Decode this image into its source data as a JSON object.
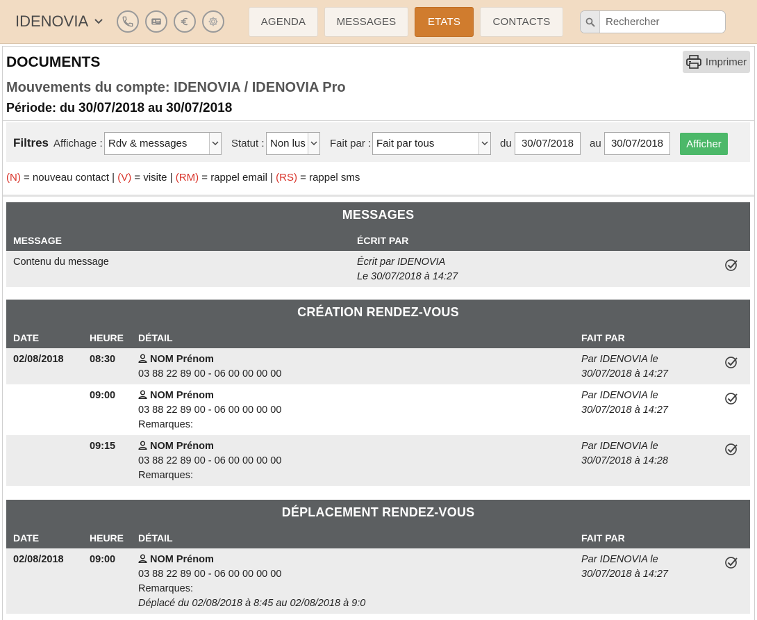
{
  "brand": {
    "name": "IDENOVIA"
  },
  "icons": [
    "phone-icon",
    "contacts-card-icon",
    "euro-icon",
    "gear-icon"
  ],
  "nav": {
    "tabs": [
      {
        "label": "AGENDA",
        "active": false
      },
      {
        "label": "MESSAGES",
        "active": false
      },
      {
        "label": "ETATS",
        "active": true
      },
      {
        "label": "CONTACTS",
        "active": false
      }
    ],
    "search_placeholder": "Rechercher"
  },
  "colors": {
    "topbar": "#f2dcc3",
    "active_tab": "#d07c2e",
    "header_gray": "#5c5f61",
    "action_green": "#4cb869",
    "legend_red": "#d9342b"
  },
  "page": {
    "title": "DOCUMENTS",
    "print_label": "Imprimer",
    "account_line": "Mouvements du compte: IDENOVIA / IDENOVIA Pro",
    "period_prefix": "Période: du",
    "period_from": "30/07/2018",
    "period_mid": "au",
    "period_to": "30/07/2018"
  },
  "filters": {
    "title": "Filtres",
    "display_label": "Affichage :",
    "display_value": "Rdv & messages",
    "status_label": "Statut :",
    "status_value": "Non lus",
    "by_label": "Fait par :",
    "by_value": "Fait par tous",
    "from_label": "du",
    "from_value": "30/07/2018",
    "to_label": "au",
    "to_value": "30/07/2018",
    "submit_label": "Afficher"
  },
  "legend": {
    "n_code": "(N)",
    "n_text": "= nouveau contact |",
    "v_code": "(V)",
    "v_text": "= visite |",
    "rm_code": "(RM)",
    "rm_text": "= rappel email |",
    "rs_code": "(RS)",
    "rs_text": "= rappel sms"
  },
  "messages": {
    "title": "MESSAGES",
    "col_message": "MESSAGE",
    "col_author": "ÉCRIT PAR",
    "rows": [
      {
        "content": "Contenu du message",
        "author": "Écrit par IDENOVIA",
        "when": "Le 30/07/2018 à 14:27"
      }
    ]
  },
  "creation": {
    "title": "CRÉATION RENDEZ-VOUS",
    "col_date": "DATE",
    "col_hour": "HEURE",
    "col_detail": "DÉTAIL",
    "col_by": "FAIT PAR",
    "rows": [
      {
        "date": "02/08/2018",
        "hour": "08:30",
        "name": "NOM Prénom",
        "phones": "03 88 22 89 00 - 06 00 00 00 00",
        "remarks": "",
        "by": "Par IDENOVIA le",
        "by_when": "30/07/2018 à 14:27"
      },
      {
        "date": "",
        "hour": "09:00",
        "name": "NOM Prénom",
        "phones": "03 88 22 89 00 - 06 00 00 00 00",
        "remarks": "Remarques:",
        "by": "Par IDENOVIA le",
        "by_when": "30/07/2018 à 14:27"
      },
      {
        "date": "",
        "hour": "09:15",
        "name": "NOM Prénom",
        "phones": "03 88 22 89 00 - 06 00 00 00 00",
        "remarks": "Remarques:",
        "by": "Par IDENOVIA le",
        "by_when": "30/07/2018 à 14:28"
      }
    ]
  },
  "moves": {
    "title": "DÉPLACEMENT RENDEZ-VOUS",
    "col_date": "DATE",
    "col_hour": "HEURE",
    "col_detail": "DÉTAIL",
    "col_by": "FAIT PAR",
    "rows": [
      {
        "date": "02/08/2018",
        "hour": "09:00",
        "name": "NOM Prénom",
        "phones": "03 88 22 89 00 - 06 00 00 00 00",
        "remarks": "Remarques:",
        "moved": "Déplacé du 02/08/2018 à 8:45 au 02/08/2018 à 9:0",
        "by": "Par IDENOVIA le",
        "by_when": "30/07/2018 à 14:27"
      }
    ]
  }
}
